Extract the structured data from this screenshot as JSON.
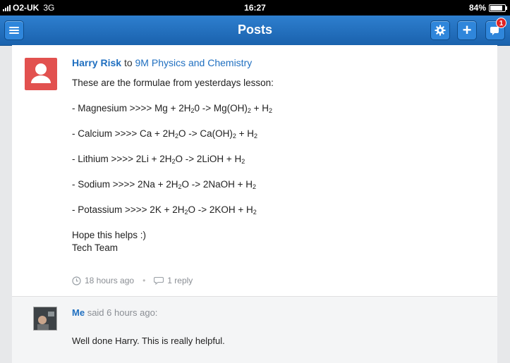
{
  "status_bar": {
    "carrier": "O2-UK",
    "network": "3G",
    "time": "16:27",
    "battery": "84%",
    "battery_level": 0.84
  },
  "nav": {
    "title": "Posts",
    "notification_count": "1",
    "accent_color": "#1f6fc0"
  },
  "post": {
    "author": "Harry Risk",
    "to_word": "to",
    "group": "9M Physics and Chemistry",
    "intro": "These are the formulae from yesterdays lesson:",
    "formulae": {
      "magnesium": {
        "label": "- Magnesium >>>> Mg +  2H",
        "a1": "2",
        "a2": "0 -> Mg(OH)",
        "a3": "2",
        "a4": " + H",
        "a5": "2"
      },
      "calcium": {
        "label": "- Calcium >>>> Ca + 2H",
        "a1": "2",
        "a2": "O -> Ca(OH)",
        "a3": "2",
        "a4": " + H",
        "a5": "2"
      },
      "lithium": {
        "label": "- Lithium >>>> 2Li + 2H",
        "a1": "2",
        "a2": "O -> 2LiOH + H",
        "a3": "2"
      },
      "sodium": {
        "label": "- Sodium >>>> 2Na + 2H",
        "a1": "2",
        "a2": "O -> 2NaOH + H",
        "a3": "2"
      },
      "potassium": {
        "label": "- Potassium >>>> 2K + 2H",
        "a1": "2",
        "a2": "O -> 2KOH + H",
        "a3": "2"
      }
    },
    "closing_line1": "Hope this helps :)",
    "closing_line2": "Tech Team",
    "time_ago": "18 hours ago",
    "separator": "•",
    "replies": "1 reply"
  },
  "reply": {
    "author": "Me",
    "said": "said 6 hours ago:",
    "text": "Well done Harry.  This is really helpful."
  }
}
